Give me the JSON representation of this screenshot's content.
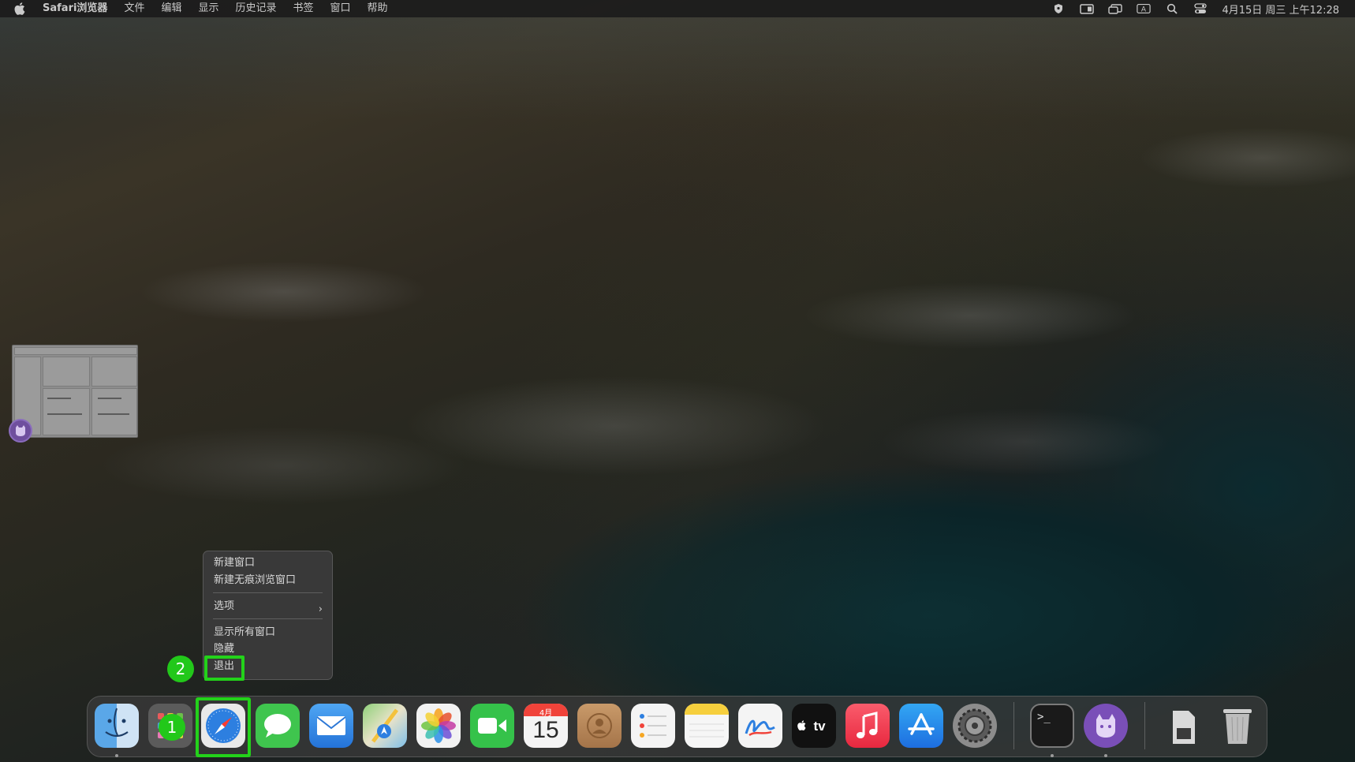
{
  "menubar": {
    "app_name": "Safari浏览器",
    "menus": [
      "文件",
      "编辑",
      "显示",
      "历史记录",
      "书签",
      "窗口",
      "帮助"
    ],
    "input_indicator": "A",
    "clock": "4月15日 周三 上午12:28",
    "status_icons": [
      "shield-icon",
      "screen-record-icon",
      "display-icon",
      "input-source-icon",
      "search-icon",
      "control-center-icon"
    ]
  },
  "context_menu": {
    "items": [
      "新建窗口",
      "新建无痕浏览窗口",
      "选项",
      "显示所有窗口",
      "隐藏",
      "退出"
    ],
    "submenu_chevron": "›"
  },
  "steps": {
    "step1": "1",
    "step2": "2"
  },
  "dock": {
    "apps": [
      "Finder",
      "Launchpad",
      "Safari",
      "Messages",
      "Mail",
      "Maps",
      "Photos",
      "FaceTime",
      "Calendar",
      "Contacts",
      "Reminders",
      "Notes",
      "Freeform",
      "Apple TV",
      "Music",
      "App Store",
      "System Settings",
      "Terminal",
      "Cat App",
      "Downloads",
      "Trash"
    ],
    "calendar_month": "4月",
    "calendar_day": "15",
    "tv_label": "tv"
  },
  "colors": {
    "highlight": "#23d21a",
    "step_marker": "#22c81a"
  }
}
